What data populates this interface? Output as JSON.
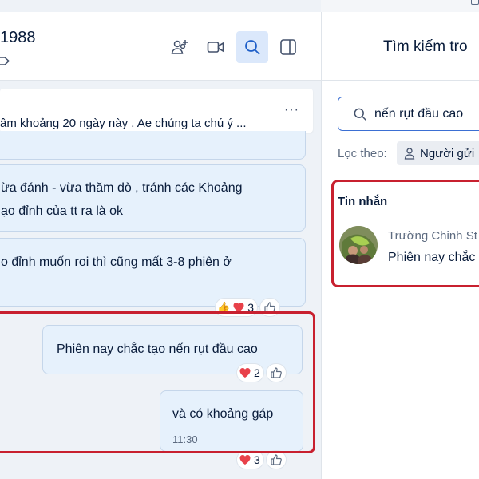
{
  "conversation": {
    "title": "1988"
  },
  "header_icons": {
    "add_member": "add-member-icon",
    "video_call": "video-camera-icon",
    "search": "search-icon",
    "toggle_panel": "side-panel-icon"
  },
  "pinned": {
    "text": "âm khoảng 20 ngày này . Ae chúng ta chú ý ...",
    "more": "···"
  },
  "messages": [
    {
      "lines": [
        "ừa đánh - vừa thăm dò , tránh các Khoảng",
        "ạo đỉnh của tt ra là ok"
      ]
    },
    {
      "lines": [
        "o đỉnh muốn roi thì cũng mất 3-8 phiên ở"
      ],
      "reaction_count": "3"
    },
    {
      "lines": [
        "Phiên nay chắc tạo nến rụt đầu cao"
      ],
      "reaction_count": "2"
    },
    {
      "lines": [
        "và có khoảng gáp"
      ],
      "time": "11:30",
      "reaction_count": "3"
    }
  ],
  "search_panel": {
    "title": "Tìm kiếm tro",
    "query": "nến rụt đầu cao",
    "filter_label": "Lọc theo:",
    "filter_chip": "Người gửi",
    "results_heading": "Tin nhắn",
    "result": {
      "sender": "Trường Chinh St",
      "snippet": "Phiên nay chắc"
    }
  },
  "colors": {
    "accent": "#3b6fd3",
    "bubble": "#e6f1fc",
    "highlight": "#c8202f",
    "reaction_heart": "#e8414a"
  }
}
